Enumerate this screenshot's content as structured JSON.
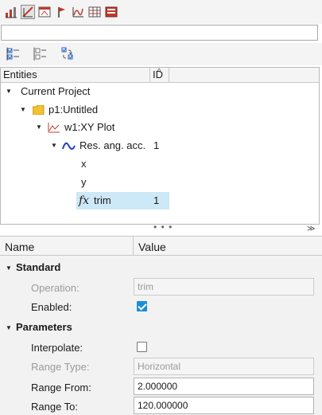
{
  "toolbar": {
    "buttons": [
      {
        "icon": "plot-create-icon"
      },
      {
        "icon": "curve-edit-icon",
        "active": true
      },
      {
        "icon": "window-layout-icon"
      },
      {
        "icon": "marker-pin-icon"
      },
      {
        "icon": "math-function-icon"
      },
      {
        "icon": "table-grid-icon"
      },
      {
        "icon": "report-icon"
      }
    ]
  },
  "filter": {
    "value": "",
    "placeholder": ""
  },
  "toolbar2": {
    "buttons": [
      {
        "icon": "select-all-icon"
      },
      {
        "icon": "deselect-icon"
      },
      {
        "icon": "invert-selection-icon"
      }
    ]
  },
  "tree": {
    "columns": {
      "entities": "Entities",
      "id": "ID"
    },
    "rows": [
      {
        "label": "Current Project",
        "id": "",
        "icon": "",
        "caret": "expanded"
      },
      {
        "label": "p1:Untitled",
        "id": "",
        "icon": "folder-icon",
        "caret": "expanded"
      },
      {
        "label": "w1:XY Plot",
        "id": "",
        "icon": "xy-plot-icon",
        "caret": "expanded"
      },
      {
        "label": "Res. ang. acc.",
        "id": "1",
        "icon": "curve-icon",
        "caret": "expanded"
      },
      {
        "label": "x",
        "id": "",
        "icon": "",
        "caret": "none"
      },
      {
        "label": "y",
        "id": "",
        "icon": "",
        "caret": "none"
      },
      {
        "label": "trim",
        "id": "1",
        "icon": "fx-icon",
        "caret": "none",
        "selected": true,
        "icon_text": "fx"
      }
    ]
  },
  "properties": {
    "columns": {
      "name": "Name",
      "value": "Value"
    },
    "sections": [
      {
        "label": "Standard"
      },
      {
        "label": "Parameters"
      }
    ],
    "operation": {
      "label": "Operation:",
      "value": "trim"
    },
    "enabled": {
      "label": "Enabled:",
      "checked": true
    },
    "interpolate": {
      "label": "Interpolate:",
      "checked": false
    },
    "range_type": {
      "label": "Range Type:",
      "value": "Horizontal"
    },
    "range_from": {
      "label": "Range From:",
      "value": "2.000000"
    },
    "range_to": {
      "label": "Range To:",
      "value": "120.000000"
    }
  },
  "colors": {
    "selection": "#cde8f6",
    "checkbox_accent": "#1a8fd6",
    "curve_blue": "#1f3fbf",
    "folder_yellow": "#f2c230"
  }
}
